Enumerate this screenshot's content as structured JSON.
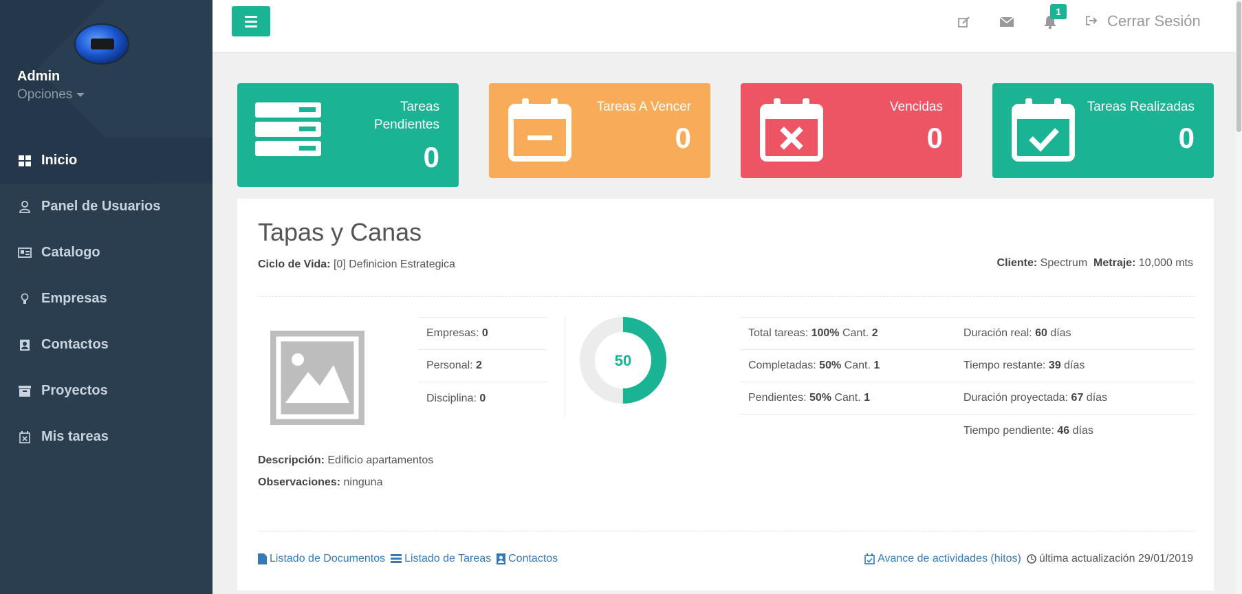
{
  "sidebar": {
    "profile": {
      "name": "Admin",
      "options_label": "Opciones"
    },
    "items": [
      {
        "label": "Inicio",
        "icon": "grid-icon"
      },
      {
        "label": "Panel de Usuarios",
        "icon": "user-icon"
      },
      {
        "label": "Catalogo",
        "icon": "id-card-icon"
      },
      {
        "label": "Empresas",
        "icon": "lightbulb-icon"
      },
      {
        "label": "Contactos",
        "icon": "contact-book-icon"
      },
      {
        "label": "Proyectos",
        "icon": "archive-icon"
      },
      {
        "label": "Mis tareas",
        "icon": "calendar-x-icon"
      }
    ]
  },
  "header": {
    "notification_count": "1",
    "logout_label": "Cerrar Sesión"
  },
  "stats": [
    {
      "label": "Tareas Pendientes",
      "value": "0",
      "color": "#1ab394"
    },
    {
      "label": "Tareas A Vencer",
      "value": "0",
      "color": "#f8ac59"
    },
    {
      "label": "Vencidas",
      "value": "0",
      "color": "#ed5565"
    },
    {
      "label": "Tareas Realizadas",
      "value": "0",
      "color": "#1ab394"
    }
  ],
  "project": {
    "title": "Tapas y Canas",
    "ciclo_label": "Ciclo de Vida:",
    "ciclo_value": "[0] Definicion Estrategica",
    "cliente_label": "Cliente:",
    "cliente_value": "Spectrum",
    "metraje_label": "Metraje:",
    "metraje_value": "10,000 mts",
    "counts": [
      {
        "label": "Empresas:",
        "value": "0"
      },
      {
        "label": "Personal:",
        "value": "2"
      },
      {
        "label": "Disciplina:",
        "value": "0"
      }
    ],
    "progress": {
      "value": "50",
      "percent": 50
    },
    "tasks": [
      {
        "label": "Total tareas:",
        "pct": "100%",
        "cant_label": "Cant.",
        "cant": "2"
      },
      {
        "label": "Completadas:",
        "pct": "50%",
        "cant_label": "Cant.",
        "cant": "1"
      },
      {
        "label": "Pendientes:",
        "pct": "50%",
        "cant_label": "Cant.",
        "cant": "1"
      }
    ],
    "durations": [
      {
        "label": "Duración real:",
        "value": "60",
        "unit": "días"
      },
      {
        "label": "Tiempo restante:",
        "value": "39",
        "unit": "días"
      },
      {
        "label": "Duración proyectada:",
        "value": "67",
        "unit": "días"
      },
      {
        "label": "Tiempo pendiente:",
        "value": "46",
        "unit": "días"
      }
    ],
    "descripcion_label": "Descripción:",
    "descripcion_value": "Edificio apartamentos",
    "observaciones_label": "Observaciones:",
    "observaciones_value": "ninguna",
    "links": {
      "documentos": "Listado de Documentos",
      "tareas": "Listado de Tareas",
      "contactos": "Contactos",
      "avance": "Avance de actividades (hitos)",
      "actualizacion": "última actualización 29/01/2019"
    }
  }
}
